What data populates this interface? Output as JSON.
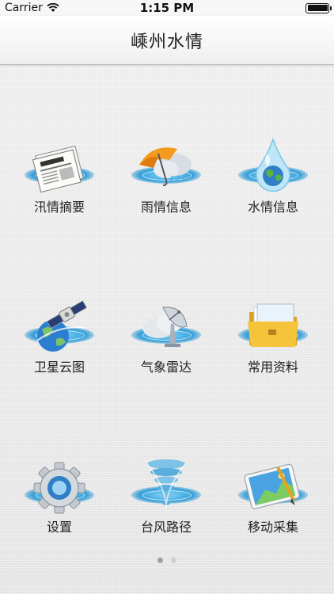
{
  "status_bar": {
    "carrier": "Carrier",
    "time": "1:15 PM",
    "battery_level": 1.0
  },
  "navbar": {
    "title": "嵊州水情"
  },
  "menu": [
    {
      "label": "汛情摘要",
      "icon": "newspaper-icon"
    },
    {
      "label": "雨情信息",
      "icon": "umbrella-rain-icon"
    },
    {
      "label": "水情信息",
      "icon": "water-drop-globe-icon"
    },
    {
      "label": "卫星云图",
      "icon": "satellite-icon"
    },
    {
      "label": "气象雷达",
      "icon": "radar-dish-icon"
    },
    {
      "label": "常用资料",
      "icon": "folder-icon"
    },
    {
      "label": "设置",
      "icon": "gear-icon"
    },
    {
      "label": "台风路径",
      "icon": "typhoon-icon"
    },
    {
      "label": "移动采集",
      "icon": "tablet-pen-icon"
    }
  ],
  "pager": {
    "pages": 2,
    "current": 1
  }
}
